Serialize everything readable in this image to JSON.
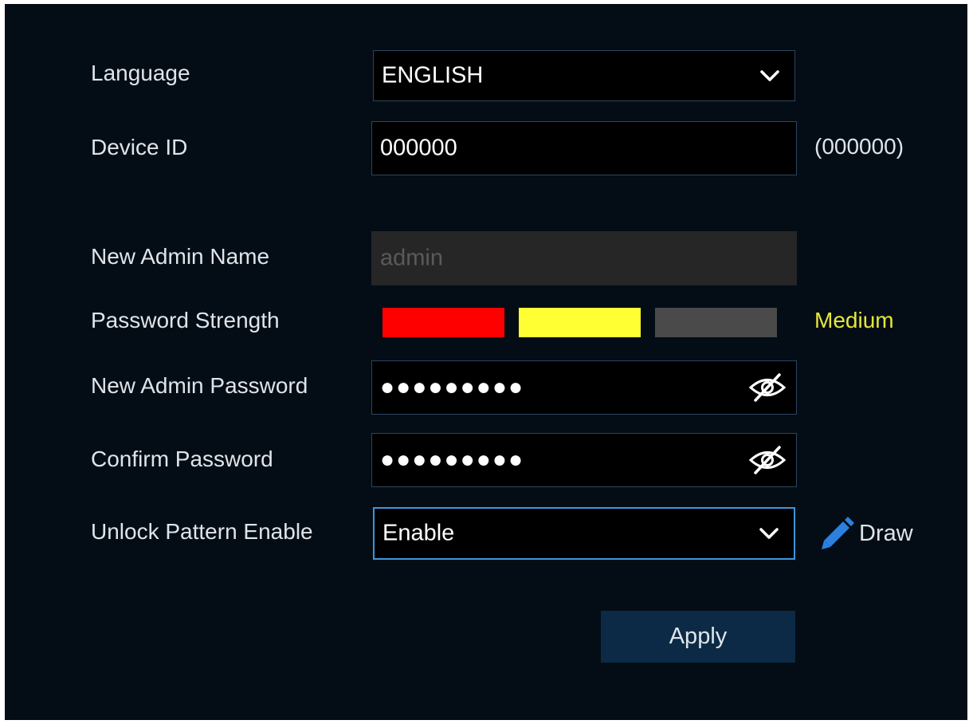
{
  "form": {
    "language": {
      "label": "Language",
      "value": "ENGLISH"
    },
    "device_id": {
      "label": "Device ID",
      "value": "000000",
      "hint": "(000000)"
    },
    "admin_name": {
      "label": "New Admin Name",
      "placeholder": "admin"
    },
    "password_strength": {
      "label": "Password Strength",
      "level": "Medium",
      "level_value": 2,
      "level_max": 3,
      "colors": [
        "#ff0000",
        "#ffff33",
        "#4a4a4a"
      ],
      "level_color": "#e6e63c"
    },
    "admin_password": {
      "label": "New Admin Password",
      "value": "●●●●●●●●●"
    },
    "confirm_password": {
      "label": "Confirm Password",
      "value": "●●●●●●●●●"
    },
    "unlock_pattern": {
      "label": "Unlock Pattern Enable",
      "value": "Enable",
      "draw_label": "Draw"
    },
    "apply_label": "Apply"
  },
  "colors": {
    "background": "#040d15",
    "field_border": "#2a4560",
    "focus_border": "#3c96e0",
    "button_bg": "#0c2a45",
    "pencil": "#2d7fe0"
  }
}
